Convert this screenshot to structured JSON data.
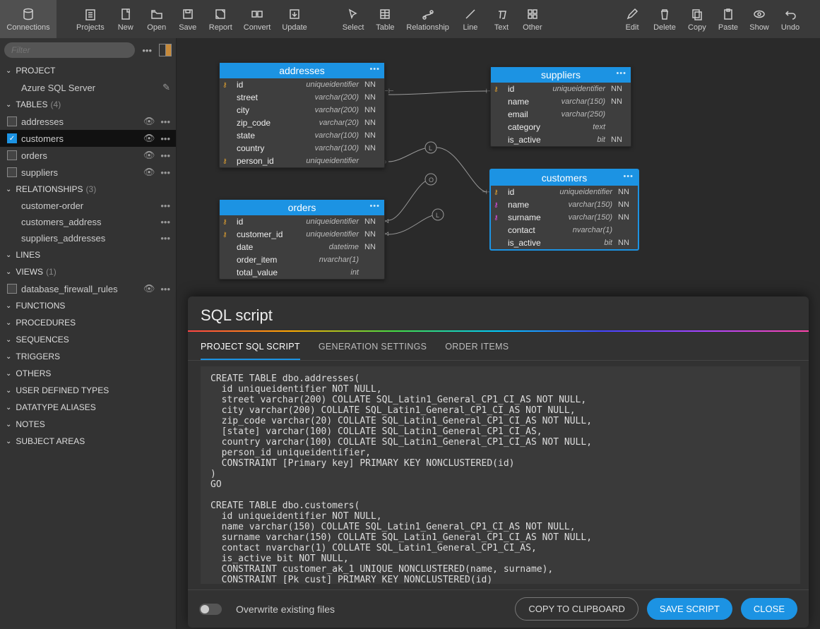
{
  "toolbar": {
    "connections": "Connections",
    "group1": [
      "Projects",
      "New",
      "Open",
      "Save",
      "Report",
      "Convert",
      "Update"
    ],
    "group2": [
      "Select",
      "Table",
      "Relationship",
      "Line",
      "Text",
      "Other"
    ],
    "group3": [
      "Edit",
      "Delete",
      "Copy",
      "Paste",
      "Show",
      "Undo"
    ]
  },
  "filter": {
    "placeholder": "Filter"
  },
  "tree": {
    "project": {
      "label": "PROJECT",
      "item": "Azure SQL Server"
    },
    "tables": {
      "label": "TABLES",
      "count": "(4)",
      "items": [
        "addresses",
        "customers",
        "orders",
        "suppliers"
      ],
      "selected": "customers"
    },
    "relationships": {
      "label": "RELATIONSHIPS",
      "count": "(3)",
      "items": [
        "customer-order",
        "customers_address",
        "suppliers_addresses"
      ]
    },
    "lines": {
      "label": "LINES"
    },
    "views": {
      "label": "VIEWS",
      "count": "(1)",
      "items": [
        "database_firewall_rules"
      ]
    },
    "functions": {
      "label": "FUNCTIONS"
    },
    "procedures": {
      "label": "PROCEDURES"
    },
    "sequences": {
      "label": "SEQUENCES"
    },
    "triggers": {
      "label": "TRIGGERS"
    },
    "others": {
      "label": "OTHERS"
    },
    "udt": {
      "label": "USER DEFINED TYPES"
    },
    "aliases": {
      "label": "DATATYPE ALIASES"
    },
    "notes": {
      "label": "NOTES"
    },
    "subject": {
      "label": "SUBJECT AREAS"
    }
  },
  "entities": {
    "addresses": {
      "title": "addresses",
      "cols": [
        {
          "key": "pk",
          "name": "id",
          "type": "uniqueidentifier",
          "nn": "NN"
        },
        {
          "key": "",
          "name": "street",
          "type": "varchar(200)",
          "nn": "NN"
        },
        {
          "key": "",
          "name": "city",
          "type": "varchar(200)",
          "nn": "NN"
        },
        {
          "key": "",
          "name": "zip_code",
          "type": "varchar(20)",
          "nn": "NN"
        },
        {
          "key": "",
          "name": "state",
          "type": "varchar(100)",
          "nn": "NN"
        },
        {
          "key": "",
          "name": "country",
          "type": "varchar(100)",
          "nn": "NN"
        },
        {
          "key": "pk",
          "name": "person_id",
          "type": "uniqueidentifier",
          "nn": ""
        }
      ]
    },
    "orders": {
      "title": "orders",
      "cols": [
        {
          "key": "pk",
          "name": "id",
          "type": "uniqueidentifier",
          "nn": "NN"
        },
        {
          "key": "pk",
          "name": "customer_id",
          "type": "uniqueidentifier",
          "nn": "NN"
        },
        {
          "key": "",
          "name": "date",
          "type": "datetime",
          "nn": "NN"
        },
        {
          "key": "",
          "name": "order_item",
          "type": "nvarchar(1)",
          "nn": ""
        },
        {
          "key": "",
          "name": "total_value",
          "type": "int",
          "nn": ""
        }
      ]
    },
    "customers": {
      "title": "customers",
      "cols": [
        {
          "key": "pk",
          "name": "id",
          "type": "uniqueidentifier",
          "nn": "NN"
        },
        {
          "key": "fk",
          "name": "name",
          "type": "varchar(150)",
          "nn": "NN"
        },
        {
          "key": "fk",
          "name": "surname",
          "type": "varchar(150)",
          "nn": "NN"
        },
        {
          "key": "",
          "name": "contact",
          "type": "nvarchar(1)",
          "nn": ""
        },
        {
          "key": "",
          "name": "is_active",
          "type": "bit",
          "nn": "NN"
        }
      ]
    },
    "suppliers": {
      "title": "suppliers",
      "cols": [
        {
          "key": "pk",
          "name": "id",
          "type": "uniqueidentifier",
          "nn": "NN"
        },
        {
          "key": "",
          "name": "name",
          "type": "varchar(150)",
          "nn": "NN"
        },
        {
          "key": "",
          "name": "email",
          "type": "varchar(250)",
          "nn": ""
        },
        {
          "key": "",
          "name": "category",
          "type": "text",
          "nn": ""
        },
        {
          "key": "",
          "name": "is_active",
          "type": "bit",
          "nn": "NN"
        }
      ]
    }
  },
  "panel": {
    "title": "SQL script",
    "tabs": [
      "PROJECT SQL SCRIPT",
      "GENERATION SETTINGS",
      "ORDER ITEMS"
    ],
    "activeTab": 0,
    "code": "CREATE TABLE dbo.addresses(\n  id uniqueidentifier NOT NULL,\n  street varchar(200) COLLATE SQL_Latin1_General_CP1_CI_AS NOT NULL,\n  city varchar(200) COLLATE SQL_Latin1_General_CP1_CI_AS NOT NULL,\n  zip_code varchar(20) COLLATE SQL_Latin1_General_CP1_CI_AS NOT NULL,\n  [state] varchar(100) COLLATE SQL_Latin1_General_CP1_CI_AS,\n  country varchar(100) COLLATE SQL_Latin1_General_CP1_CI_AS NOT NULL,\n  person_id uniqueidentifier,\n  CONSTRAINT [Primary key] PRIMARY KEY NONCLUSTERED(id)\n)\nGO\n\nCREATE TABLE dbo.customers(\n  id uniqueidentifier NOT NULL,\n  name varchar(150) COLLATE SQL_Latin1_General_CP1_CI_AS NOT NULL,\n  surname varchar(150) COLLATE SQL_Latin1_General_CP1_CI_AS NOT NULL,\n  contact nvarchar(1) COLLATE SQL_Latin1_General_CP1_CI_AS,\n  is_active bit NOT NULL,\n  CONSTRAINT customer_ak_1 UNIQUE NONCLUSTERED(name, surname),\n  CONSTRAINT [Pk cust] PRIMARY KEY NONCLUSTERED(id)",
    "overwrite": "Overwrite existing files",
    "copy": "COPY TO CLIPBOARD",
    "save": "SAVE SCRIPT",
    "close": "CLOSE"
  }
}
